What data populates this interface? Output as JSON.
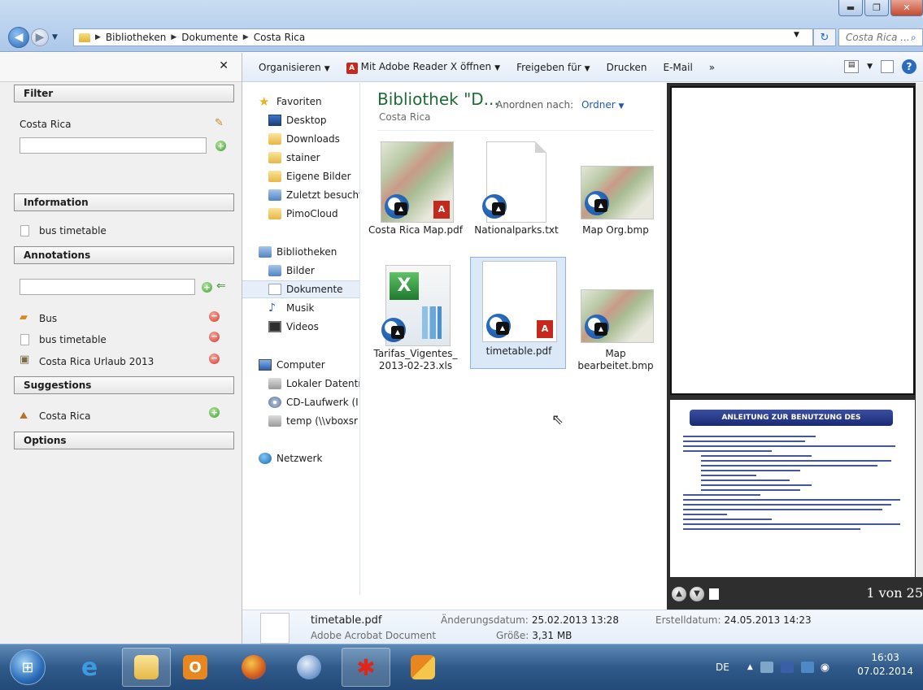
{
  "window": {
    "controls": {
      "minimize": "▬",
      "maximize": "❐",
      "close": "✕"
    }
  },
  "address": {
    "crumbs": [
      "Bibliotheken",
      "Dokumente",
      "Costa Rica"
    ],
    "search_placeholder": "Costa Rica ..."
  },
  "sidebar": {
    "filter": {
      "title": "Filter",
      "label": "Costa Rica",
      "input_value": ""
    },
    "information": {
      "title": "Information",
      "item": "bus timetable"
    },
    "annotations": {
      "title": "Annotations",
      "input_value": "",
      "items": [
        "Bus",
        "bus timetable",
        "Costa Rica Urlaub 2013"
      ]
    },
    "suggestions": {
      "title": "Suggestions",
      "item": "Costa Rica"
    },
    "options": {
      "title": "Options"
    }
  },
  "toolbar": {
    "organize": "Organisieren",
    "open_with": "Mit Adobe Reader X öffnen",
    "share": "Freigeben für",
    "print": "Drucken",
    "email": "E-Mail",
    "more": "»"
  },
  "navpane": {
    "favorites": "Favoriten",
    "desktop": "Desktop",
    "downloads": "Downloads",
    "stainer": "stainer",
    "pictures": "Eigene Bilder",
    "recent": "Zuletzt besucht",
    "pimocloud": "PimoCloud",
    "libraries": "Bibliotheken",
    "images": "Bilder",
    "documents": "Dokumente",
    "music": "Musik",
    "videos": "Videos",
    "computer": "Computer",
    "local_drive": "Lokaler Datentr",
    "cd_drive": "CD-Laufwerk (I",
    "temp": "temp (\\\\vboxsr",
    "network": "Netzwerk"
  },
  "content": {
    "title": "Bibliothek \"D...",
    "subtitle": "Costa Rica",
    "arrange_label": "Anordnen nach:",
    "arrange_value": "Ordner",
    "files": [
      {
        "name": "Costa Rica Map.pdf"
      },
      {
        "name": "Nationalparks.txt"
      },
      {
        "name": "Map Org.bmp"
      },
      {
        "name": "Tarifas_Vigentes_ 2013-02-23.xls"
      },
      {
        "name": "timetable.pdf"
      },
      {
        "name": "Map bearbeitet.bmp"
      }
    ]
  },
  "preview": {
    "doc_heading": "ANLEITUNG ZUR BENUTZUNG DES BUSFAHRPLANS",
    "page_count": "1 von 25"
  },
  "details": {
    "name": "timetable.pdf",
    "type": "Adobe Acrobat Document",
    "modified_label": "Änderungsdatum:",
    "modified_value": "25.02.2013 13:28",
    "size_label": "Größe:",
    "size_value": "3,31 MB",
    "created_label": "Erstelldatum:",
    "created_value": "24.05.2013 14:23"
  },
  "taskbar": {
    "language": "DE",
    "time": "16:03",
    "date": "07.02.2014"
  },
  "colors": {
    "title_green": "#1e6b37",
    "link_blue": "#2158b4",
    "taskbar": "#2f5a8a"
  }
}
